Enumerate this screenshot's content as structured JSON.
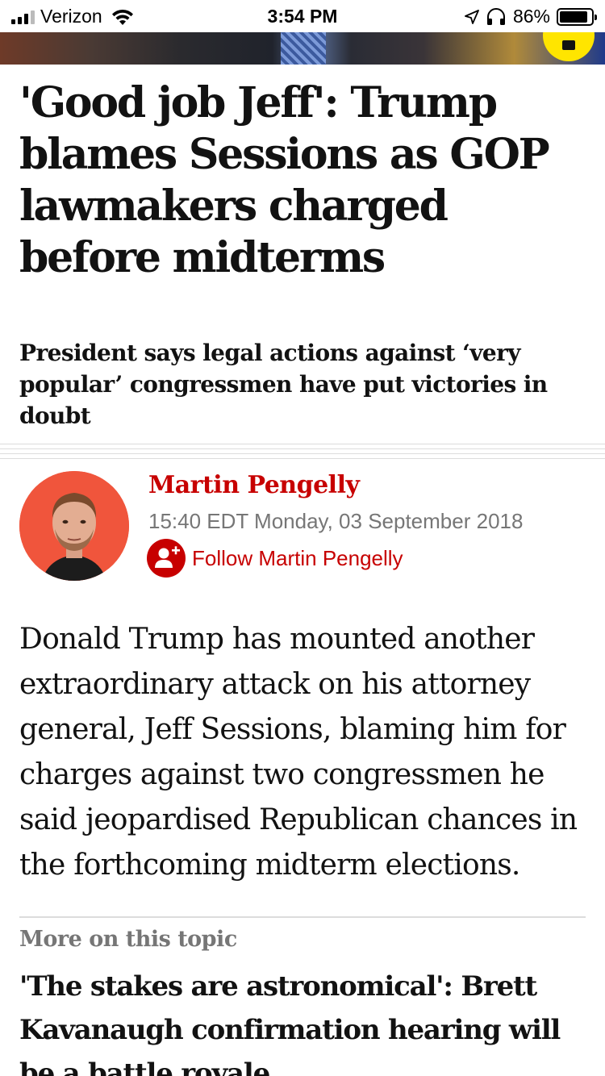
{
  "status_bar": {
    "carrier": "Verizon",
    "time": "3:54 PM",
    "battery_percent": "86%",
    "battery_level": 0.86,
    "icons": [
      "signal-icon",
      "wifi-icon",
      "location-icon",
      "headphones-icon",
      "battery-icon"
    ]
  },
  "article": {
    "headline": "'Good job Jeff': Trump blames Sessions as GOP lawmakers charged before midterms",
    "standfirst": "President says legal actions against ‘very popular’ congressmen have put victories in doubt",
    "author": "Martin Pengelly",
    "dateline": "15:40 EDT Monday, 03 September 2018",
    "follow_label": "Follow Martin Pengelly",
    "body": "Donald Trump has mounted another extraordinary attack on his attorney general, Jeff Sessions, blaming him for charges against two congressmen he said jeopardised Republican chances in the forthcoming midterm elections."
  },
  "more_on_topic": {
    "label": "More on this topic",
    "title": "'The stakes are astronomical': Brett Kavanaugh confirmation hearing will be a battle royale"
  },
  "colors": {
    "accent_red": "#c70000",
    "avatar_bg": "#f0553c",
    "badge_yellow": "#ffe500",
    "muted_text": "#767676"
  }
}
